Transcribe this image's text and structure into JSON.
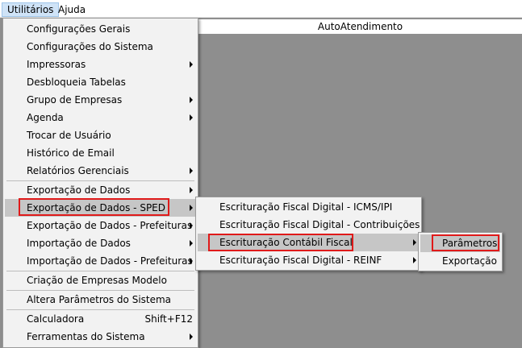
{
  "menubar": {
    "utilitarios": "Utilitários",
    "ajuda": "Ajuda"
  },
  "window": {
    "title": "AutoAtendimento"
  },
  "main_menu": {
    "items": [
      "Configurações Gerais",
      "Configurações do Sistema",
      "Impressoras",
      "Desbloqueia Tabelas",
      "Grupo de Empresas",
      "Agenda",
      "Trocar de Usuário",
      "Histórico de Email",
      "Relatórios Gerenciais",
      "Exportação de Dados",
      "Exportação de Dados - SPED",
      "Exportação de Dados - Prefeituras",
      "Importação de Dados",
      "Importação de Dados - Prefeituras",
      "Criação de Empresas Modelo",
      "Altera Parâmetros do Sistema",
      "Calculadora",
      "Ferramentas do Sistema"
    ],
    "calculadora_shortcut": "Shift+F12"
  },
  "sped_menu": {
    "items": [
      "Escrituração Fiscal Digital - ICMS/IPI",
      "Escrituração Fiscal Digital - Contribuições",
      "Escrituração Contábil Fiscal",
      "Escrituração Fiscal Digital - REINF"
    ]
  },
  "ecf_menu": {
    "items": [
      "Parâmetros",
      "Exportação"
    ]
  },
  "colors": {
    "highlight_box": "#e01a1a",
    "menu_bg": "#f2f2f2",
    "hover": "#c6c6c6"
  }
}
